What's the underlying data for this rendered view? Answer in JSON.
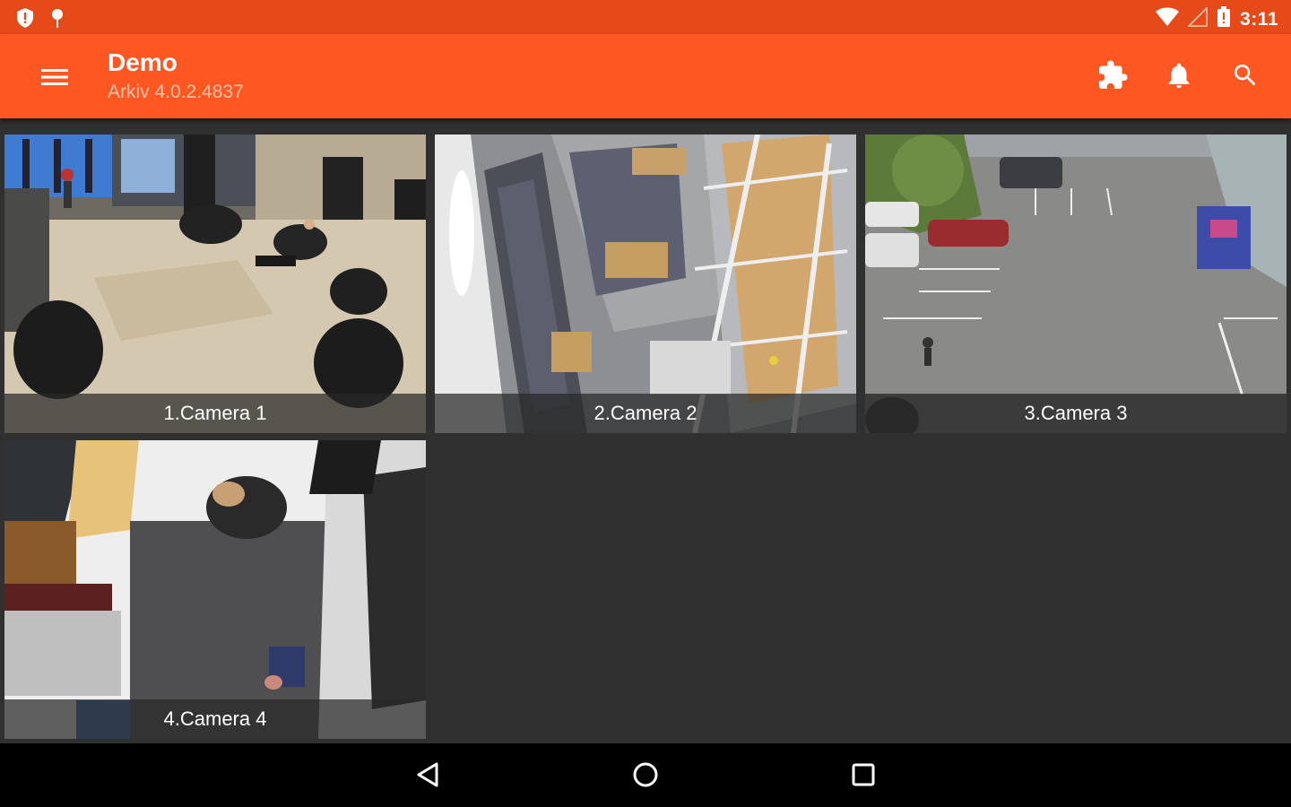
{
  "status_bar": {
    "time": "3:11",
    "icons": [
      "shield-notification-icon",
      "location-pin-icon",
      "wifi-icon",
      "signal-icon",
      "battery-icon"
    ]
  },
  "app_bar": {
    "title": "Demo",
    "subtitle": "Arkiv 4.0.2.4837",
    "menu_icon": "hamburger-menu-icon",
    "actions": [
      "puzzle-plugin-icon",
      "bell-notification-icon",
      "search-icon"
    ]
  },
  "cameras": [
    {
      "label": "1.Camera 1"
    },
    {
      "label": "2.Camera 2"
    },
    {
      "label": "3.Camera 3"
    },
    {
      "label": "4.Camera 4"
    }
  ],
  "nav_bar": {
    "icons": [
      "back-triangle-icon",
      "home-circle-icon",
      "recents-square-icon"
    ]
  },
  "colors": {
    "status_bar": "#e64a19",
    "app_bar": "#ff5722",
    "background": "#303030",
    "nav_bar": "#000000"
  }
}
